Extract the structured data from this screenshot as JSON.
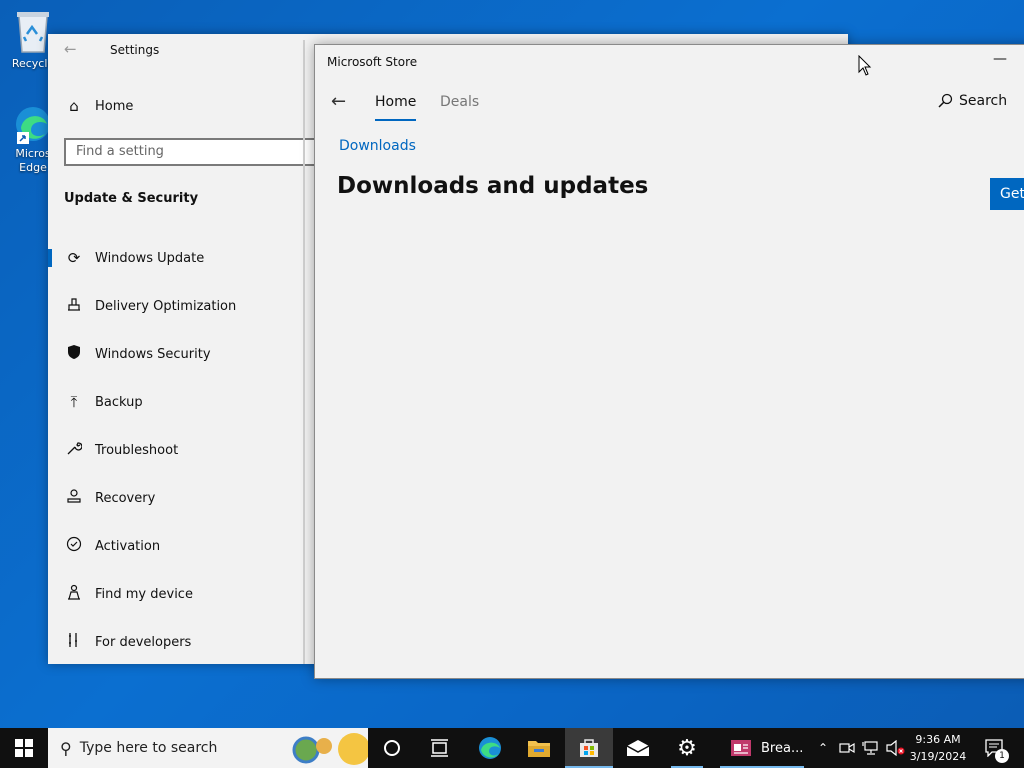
{
  "desktop": {
    "recycle_label": "Recycle",
    "edge_label_1": "Micros",
    "edge_label_2": "Edge"
  },
  "settings": {
    "title": "Settings",
    "home": "Home",
    "search_placeholder": "Find a setting",
    "section": "Update & Security",
    "items": [
      {
        "label": "Windows Update",
        "icon": "sync-icon"
      },
      {
        "label": "Delivery Optimization",
        "icon": "delivery-icon"
      },
      {
        "label": "Windows Security",
        "icon": "shield-icon"
      },
      {
        "label": "Backup",
        "icon": "upload-icon"
      },
      {
        "label": "Troubleshoot",
        "icon": "wrench-icon"
      },
      {
        "label": "Recovery",
        "icon": "recovery-icon"
      },
      {
        "label": "Activation",
        "icon": "check-circle-icon"
      },
      {
        "label": "Find my device",
        "icon": "person-location-icon"
      },
      {
        "label": "For developers",
        "icon": "developer-icon"
      }
    ]
  },
  "store": {
    "window_title": "Microsoft Store",
    "tabs": [
      "Home",
      "Deals"
    ],
    "search_label": "Search",
    "breadcrumb": "Downloads",
    "page_title": "Downloads and updates",
    "get_button": "Get"
  },
  "taskbar": {
    "search_placeholder": "Type here to search",
    "task_label": "Brea...",
    "time": "9:36 AM",
    "date": "3/19/2024",
    "notification_count": "1"
  },
  "colors": {
    "accent": "#0067c0",
    "taskbar": "#101010",
    "desktop": "#0b6fd0"
  }
}
